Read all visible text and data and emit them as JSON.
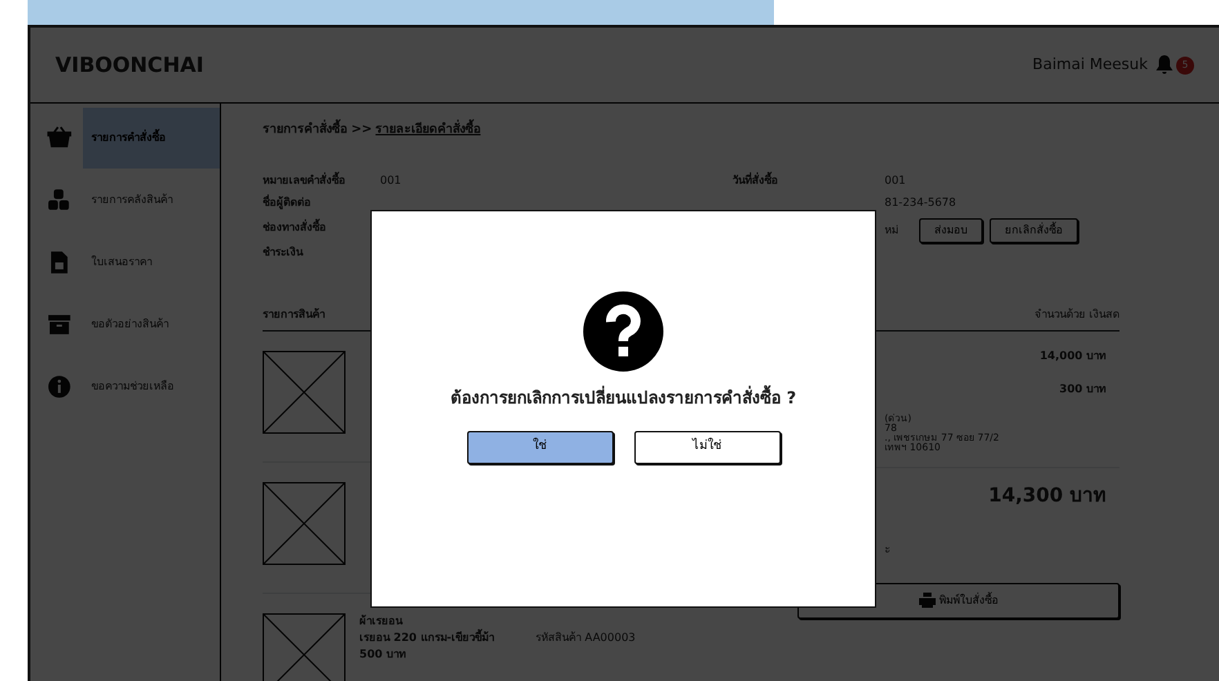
{
  "header": {
    "brand": "VIBOONCHAI",
    "user": "Baimai Meesuk",
    "notification_count": "5"
  },
  "sidebar": {
    "items": [
      {
        "label": "รายการคำสั่งซื้อ",
        "selected": true
      },
      {
        "label": "รายการคลังสินค้า",
        "selected": false
      },
      {
        "label": "ใบเสนอราคา",
        "selected": false
      },
      {
        "label": "ขอตัวอย่างสินค้า",
        "selected": false
      },
      {
        "label": "ขอความช่วยเหลือ",
        "selected": false
      }
    ]
  },
  "breadcrumb": {
    "parent": "รายการคำสั่งซื้อ >>",
    "current": "รายละเอียดคำสั่งซื้อ"
  },
  "order_fields": [
    {
      "label": "หมายเลขคำสั่งซื้อ",
      "value": "001"
    },
    {
      "label": "ชื่อผู้ติดต่อ"
    },
    {
      "label": "ช่องทางสั่งซื้อ"
    },
    {
      "label": "ชำระเงิน"
    }
  ],
  "right_fields": [
    {
      "label": "วันที่สั่งซื้อ",
      "value": "001"
    },
    {
      "value": "81-234-5678"
    },
    {
      "value": "หม่"
    }
  ],
  "action_buttons": [
    "ส่งมอบ",
    "ยกเลิกสั่งซื้อ"
  ],
  "items_heading": "รายการสินค้า",
  "price_heading": "จำนวนด้วย เงินสด",
  "prices": [
    "14,000 บาท",
    "300 บาท"
  ],
  "address_lines": [
    "(ด่วน)",
    "78",
    "., เพชรเกษม 77 ซอย 77/2",
    "เทพฯ 10610"
  ],
  "total": "14,300 บาท",
  "note": "ะ",
  "print_button": "พิมพ์ใบสั่งซื้อ",
  "last_product": {
    "name": "ผ้าเรยอน",
    "description": "เรยอน 220 แกรม-เขียวขี้ม้า",
    "code": "รหัสสินค้า AA00003",
    "price": "500 บาท"
  },
  "dialog": {
    "message": "ต้องการยกเลิกการเปลี่ยนแปลงรายการคำสั่งซื้อ ?",
    "buttons": [
      {
        "label": "ใช่",
        "selected": true
      },
      {
        "label": "ไม่ใช่",
        "selected": false
      }
    ]
  }
}
